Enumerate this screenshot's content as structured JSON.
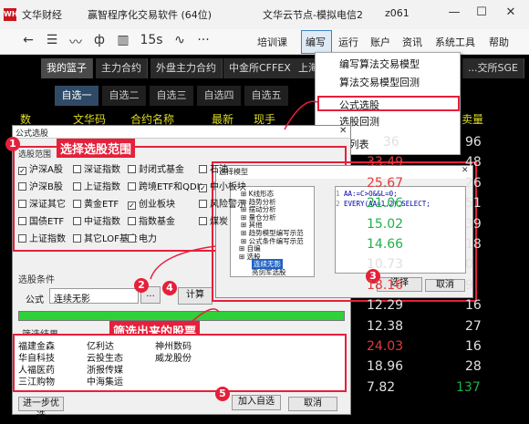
{
  "titlebar": {
    "app_name": "文华财经",
    "product": "赢智程序化交易软件 (64位)",
    "node": "文华云节点-模拟电信2",
    "code": "z061"
  },
  "toolbar": {
    "training": "培训课",
    "menus": [
      "编写",
      "运行",
      "账户",
      "资讯",
      "系统工具",
      "帮助"
    ]
  },
  "market_tabs": [
    "我的篮子",
    "主力合约",
    "外盘主力合约",
    "中金所CFFEX",
    "上海",
    "...交所SGE"
  ],
  "sub_tabs": [
    "自选一",
    "自选二",
    "自选三",
    "自选四",
    "自选五"
  ],
  "columns": [
    "数",
    "文华码",
    "合约名称",
    "最新",
    "现手",
    "卖量"
  ],
  "right_values": [
    {
      "a": "36",
      "b": "96",
      "ca": "#e0e0e0",
      "cb": "#e0e0e0"
    },
    {
      "a": "33.49",
      "b": "48",
      "ca": "#e23b3b",
      "cb": "#e0e0e0"
    },
    {
      "a": "25.67",
      "b": "26",
      "ca": "#e23b3b",
      "cb": "#e0e0e0"
    },
    {
      "a": "21.06",
      "b": "51",
      "ca": "#1fb24a",
      "cb": "#e0e0e0"
    },
    {
      "a": "15.02",
      "b": "39",
      "ca": "#1fb24a",
      "cb": "#e0e0e0"
    },
    {
      "a": "14.66",
      "b": "18",
      "ca": "#1fb24a",
      "cb": "#e0e0e0"
    },
    {
      "a": "10.73",
      "b": "0",
      "ca": "#e0e0e0",
      "cb": "#e0e0e0"
    },
    {
      "a": "18.16",
      "b": "9",
      "ca": "#e23b3b",
      "cb": "#e0e0e0"
    },
    {
      "a": "12.29",
      "b": "16",
      "ca": "#e0e0e0",
      "cb": "#e0e0e0"
    },
    {
      "a": "12.38",
      "b": "27",
      "ca": "#e0e0e0",
      "cb": "#e0e0e0"
    },
    {
      "a": "24.03",
      "b": "16",
      "ca": "#e23b3b",
      "cb": "#e0e0e0"
    },
    {
      "a": "18.96",
      "b": "28",
      "ca": "#e0e0e0",
      "cb": "#e0e0e0"
    },
    {
      "a": "7.82",
      "b": "137",
      "ca": "#e0e0e0",
      "cb": "#1fb24a"
    }
  ],
  "dropdown": {
    "items": [
      "编写算法交易模型",
      "算法交易模型回测",
      "公式选股",
      "选股回测",
      "...列表"
    ],
    "selected_index": 2
  },
  "dialog": {
    "title": "公式选股",
    "range_group": "选股范围",
    "annotation_1": "选择选股范围",
    "checkboxes": [
      {
        "label": "沪深A股",
        "checked": true
      },
      {
        "label": "深证指数",
        "checked": false
      },
      {
        "label": "封闭式基金",
        "checked": false
      },
      {
        "label": "石油",
        "checked": false
      },
      {
        "label": "沪深B股",
        "checked": false
      },
      {
        "label": "上证指数",
        "checked": false
      },
      {
        "label": "跨境ETF和QDII",
        "checked": false
      },
      {
        "label": "中小板块",
        "checked": true
      },
      {
        "label": "深证其它",
        "checked": false
      },
      {
        "label": "黄金ETF",
        "checked": false
      },
      {
        "label": "创业板块",
        "checked": true
      },
      {
        "label": "风险警示",
        "checked": false
      },
      {
        "label": "国债ETF",
        "checked": false
      },
      {
        "label": "中证指数",
        "checked": false
      },
      {
        "label": "指数基金",
        "checked": false
      },
      {
        "label": "煤炭",
        "checked": false
      },
      {
        "label": "上证指数",
        "checked": false
      },
      {
        "label": "其它LOF基金",
        "checked": false
      },
      {
        "label": "电力",
        "checked": false
      }
    ],
    "condition_group": "选股条件",
    "formula_label": "公式",
    "formula_value": "连续无影",
    "browse_label": "...",
    "calc_label": "计算",
    "results_group": "筛选结果",
    "annotation_results": "筛选出来的股票",
    "results": [
      "福建金森",
      "亿利达",
      "神州数码",
      "华自科技",
      "云投生态",
      "威龙股份",
      "人福医药",
      "浙报传媒",
      "三江购物",
      "中海集运"
    ],
    "further_label": "进一步优选",
    "add_label": "加入自选",
    "cancel_label": "取消"
  },
  "model_dialog": {
    "title": "选择模型",
    "tree": [
      "K线形态",
      "趋势分析",
      "摆动分析",
      "量仓分析",
      "其他",
      "趋势模型编写示范",
      "公式条件编写示范",
      "自编",
      "选股",
      "连续无影",
      "亮剑军选股"
    ],
    "selected_tree": "连续无影",
    "code": [
      "AA:=C>O&&L=0;",
      "EVERY(AA=1,2),SELECT;"
    ],
    "ok_label": "选择",
    "cancel_label": "取消"
  },
  "badges": [
    "1",
    "2",
    "3",
    "4",
    "5"
  ],
  "colors": {
    "accent": "#e5203a",
    "up": "#e23b3b",
    "down": "#1fb24a",
    "progress": "#2fd13a"
  }
}
